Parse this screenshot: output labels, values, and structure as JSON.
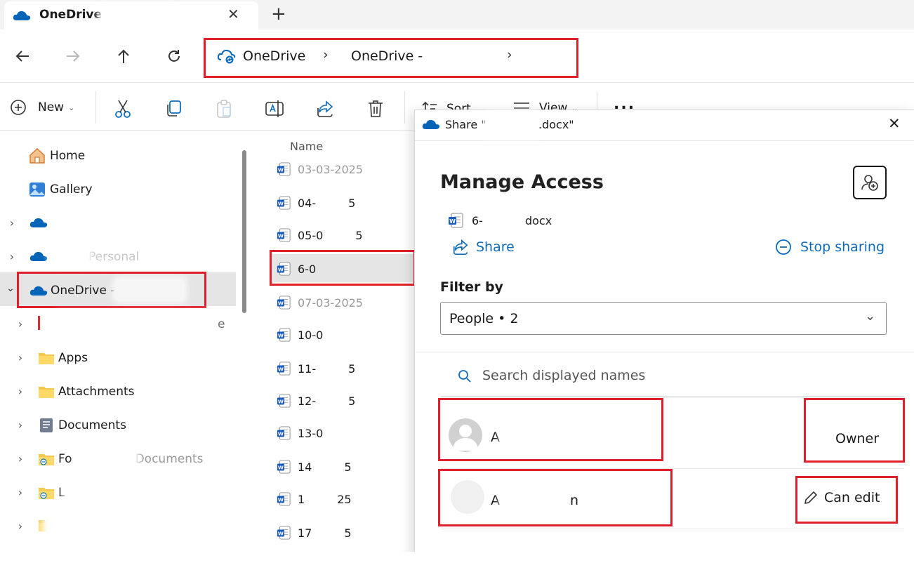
{
  "window": {
    "tab_title": "OneDrive - ",
    "new_tab_symbol": "+"
  },
  "breadcrumb": {
    "root": "OneDrive",
    "current": "OneDrive - "
  },
  "toolbar": {
    "new_label": "New",
    "sort_label": "Sort",
    "view_label": "View",
    "more_label": "..."
  },
  "sidebar": {
    "home": "Home",
    "gallery": "Gallery",
    "personal": "Personal",
    "onedrive_org": "OneDrive - ",
    "item_e": "e",
    "apps": "Apps",
    "attachments": "Attachments",
    "documents": "Documents",
    "forms": "Fo",
    "forms_tail": "Documents",
    "l_item": "L"
  },
  "filelist": {
    "header": "Name",
    "files": [
      "03-03-2025",
      "04-",
      "05-0",
      "6-0",
      "07-03-2025",
      "10-0",
      "11-",
      "12-",
      "13-0",
      "14",
      "1",
      "17"
    ],
    "file_tails": [
      "",
      "5",
      "5",
      "",
      "",
      "",
      "5",
      "5",
      "",
      "5",
      "25",
      "5"
    ]
  },
  "share_panel": {
    "title": "Share \"",
    "title_end": ".docx\"",
    "heading": "Manage Access",
    "file_name_start": "6-",
    "file_name_end": "docx",
    "share_label": "Share",
    "stop_sharing_label": "Stop sharing",
    "filter_label": "Filter by",
    "filter_value": "People • 2",
    "search_placeholder": "Search displayed names",
    "people": [
      {
        "name": "A",
        "role": "Owner"
      },
      {
        "name": "A",
        "name_tail": "n",
        "role": "Can edit"
      }
    ]
  },
  "colors": {
    "accent": "#0f6cbd",
    "highlight_red": "#e01f2c",
    "onedrive_blue": "#0364b8"
  }
}
